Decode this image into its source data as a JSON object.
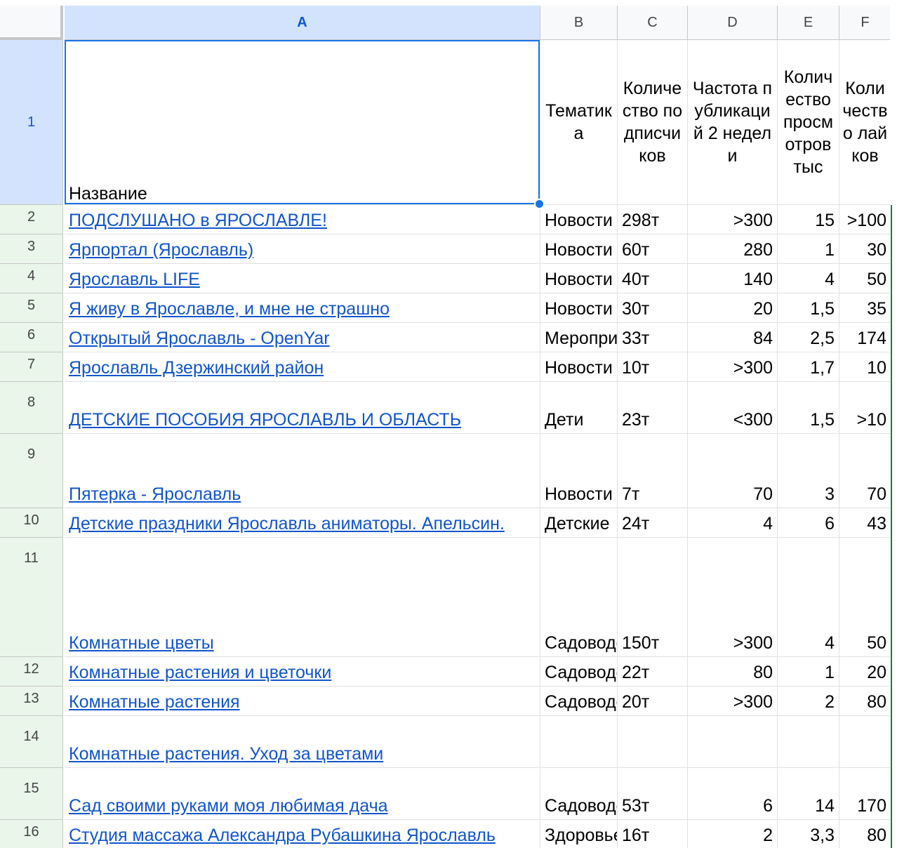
{
  "columns": [
    "A",
    "B",
    "C",
    "D",
    "E",
    "F"
  ],
  "header_row": {
    "number": "1",
    "cells": [
      "Название",
      "Тематика",
      "Количество подписчиков",
      "Частота публикаций 2 недели",
      "Количество просмотров тыс",
      "Количество лайков"
    ]
  },
  "rows": [
    {
      "n": "2",
      "name": "ПОДСЛУШАНО в ЯРОСЛАВЛЕ!",
      "topic": "Новости",
      "subs": "298т",
      "freq": ">300",
      "views": "15",
      "likes": ">100"
    },
    {
      "n": "3",
      "name": "Ярпортал (Ярославль)",
      "topic": "Новости",
      "subs": "60т",
      "freq": "280",
      "views": "1",
      "likes": "30"
    },
    {
      "n": "4",
      "name": "Ярославль LIFE",
      "topic": "Новости",
      "subs": "40т",
      "freq": "140",
      "views": "4",
      "likes": "50"
    },
    {
      "n": "5",
      "name": "Я живу в Ярославле, и мне не страшно",
      "topic": "Новости",
      "subs": "30т",
      "freq": "20",
      "views": "1,5",
      "likes": "35"
    },
    {
      "n": "6",
      "name": "Открытый Ярославль - OpenYar",
      "topic": "Мероприятия",
      "subs": "33т",
      "freq": "84",
      "views": "2,5",
      "likes": "174"
    },
    {
      "n": "7",
      "name": "Ярославль Дзержинский район",
      "topic": "Новости",
      "subs": "10т",
      "freq": ">300",
      "views": "1,7",
      "likes": "10"
    },
    {
      "n": "8",
      "name": "ДЕТСКИЕ ПОСОБИЯ ЯРОСЛАВЛЬ И ОБЛАСТЬ",
      "topic": "Дети",
      "subs": "23т",
      "freq": "<300",
      "views": "1,5",
      "likes": ">10"
    },
    {
      "n": "9",
      "name": "Пятерка - Ярославль",
      "topic": "Новости",
      "subs": "7т",
      "freq": "70",
      "views": "3",
      "likes": "70"
    },
    {
      "n": "10",
      "name": "Детские праздники Ярославль аниматоры. Апельсин.",
      "topic": "Детские",
      "subs": "24т",
      "freq": "4",
      "views": "6",
      "likes": "43"
    },
    {
      "n": "11",
      "name": "Комнатные цветы",
      "topic": "Садоводство",
      "subs": "150т",
      "freq": ">300",
      "views": "4",
      "likes": "50"
    },
    {
      "n": "12",
      "name": "Комнатные растения и цветочки",
      "topic": "Садоводство",
      "subs": "22т",
      "freq": "80",
      "views": "1",
      "likes": "20"
    },
    {
      "n": "13",
      "name": "Комнатные растения ",
      "topic": "Садоводство",
      "subs": "20т",
      "freq": ">300",
      "views": "2",
      "likes": "80"
    },
    {
      "n": "14",
      "name": "Комнатные растения. Уход за цветами",
      "topic": "",
      "subs": "",
      "freq": "",
      "views": "",
      "likes": ""
    },
    {
      "n": "15",
      "name": "Сад своими руками моя любимая дача",
      "topic": "Садоводство",
      "subs": "53т",
      "freq": "6",
      "views": "14",
      "likes": "170"
    },
    {
      "n": "16",
      "name": "Студия массажа Александра Рубашкина Ярославль",
      "topic": "Здоровье",
      "subs": "16т",
      "freq": "2",
      "views": "3,3",
      "likes": "80"
    }
  ]
}
